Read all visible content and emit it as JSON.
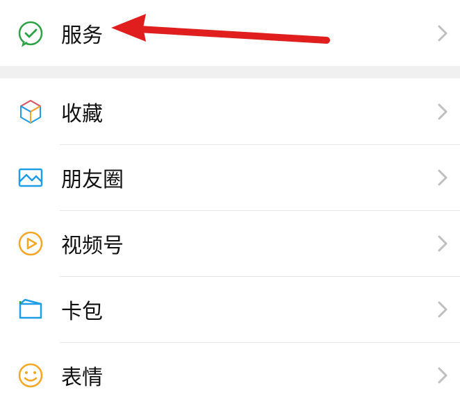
{
  "groups": [
    {
      "items": [
        {
          "id": "services",
          "label": "服务",
          "icon": "checkmark-bubble-icon"
        }
      ]
    },
    {
      "items": [
        {
          "id": "favorites",
          "label": "收藏",
          "icon": "cube-icon"
        },
        {
          "id": "moments",
          "label": "朋友圈",
          "icon": "picture-icon"
        },
        {
          "id": "channels",
          "label": "视频号",
          "icon": "play-circle-icon"
        },
        {
          "id": "cards",
          "label": "卡包",
          "icon": "card-folder-icon"
        },
        {
          "id": "stickers",
          "label": "表情",
          "icon": "smiley-icon"
        }
      ]
    }
  ],
  "annotation": {
    "type": "arrow",
    "points_to": "services"
  },
  "colors": {
    "green": "#2BA245",
    "blue": "#1E9CE8",
    "orange": "#F6A623",
    "red_edge": "#E7525B",
    "chevron": "#bfbfbf",
    "arrow": "#E11E1E"
  }
}
